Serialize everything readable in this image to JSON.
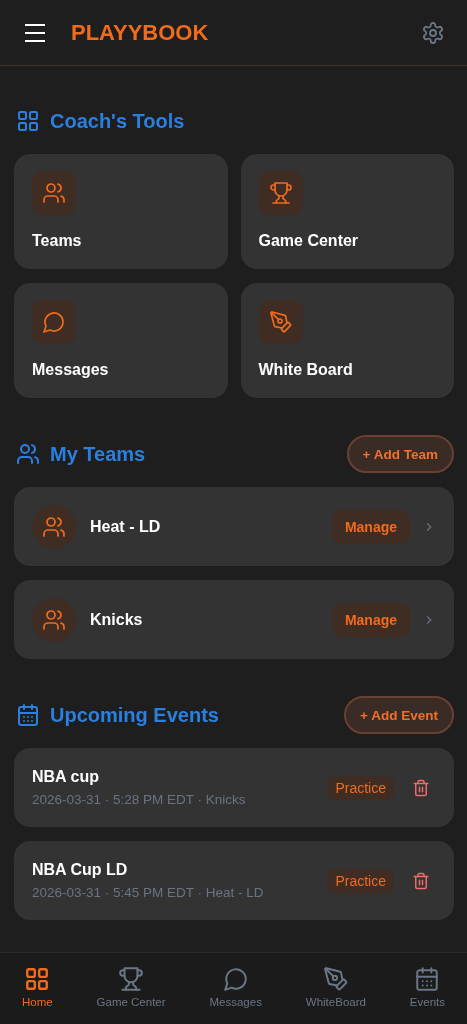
{
  "header": {
    "title": "PLAYYBOOK"
  },
  "coach_tools": {
    "title": "Coach's Tools",
    "items": [
      {
        "kind": "teams",
        "label": "Teams"
      },
      {
        "kind": "games",
        "label": "Game Center"
      },
      {
        "kind": "messages",
        "label": "Messages"
      },
      {
        "kind": "board",
        "label": "White Board"
      }
    ]
  },
  "my_teams": {
    "title": "My Teams",
    "add_button": "+ Add Team",
    "teams": [
      {
        "name": "Heat - LD",
        "action": "Manage"
      },
      {
        "name": "Knicks",
        "action": "Manage"
      }
    ]
  },
  "upcoming_events": {
    "title": "Upcoming Events",
    "add_button": "+ Add Event",
    "events": [
      {
        "title": "NBA cup",
        "meta": "2026-03-31 · 5:28 PM EDT · Knicks",
        "tag": "Practice"
      },
      {
        "title": "NBA Cup LD",
        "meta": "2026-03-31 · 5:45 PM EDT · Heat - LD",
        "tag": "Practice"
      }
    ]
  },
  "bottom_nav": [
    {
      "kind": "home",
      "label": "Home",
      "selected": true
    },
    {
      "kind": "games",
      "label": "Game Center",
      "selected": false
    },
    {
      "kind": "messages",
      "label": "Messages",
      "selected": false
    },
    {
      "kind": "board",
      "label": "WhiteBoard",
      "selected": false
    },
    {
      "kind": "events",
      "label": "Events",
      "selected": false
    }
  ]
}
